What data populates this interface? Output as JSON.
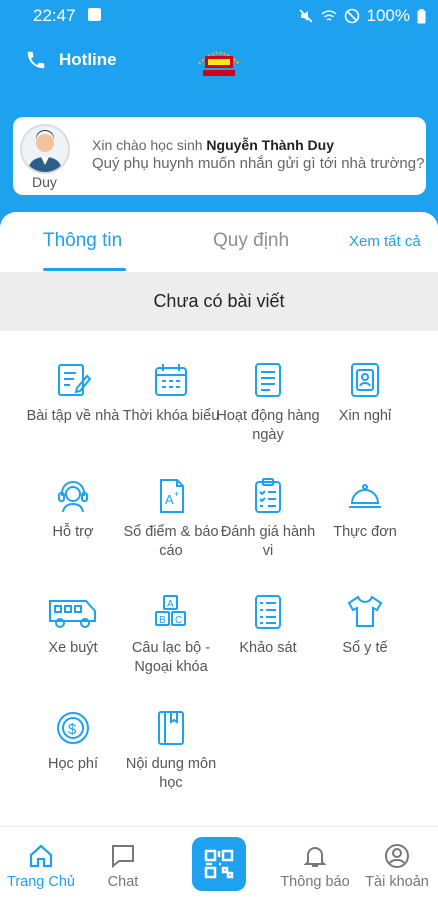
{
  "status": {
    "time": "22:47",
    "battery": "100%"
  },
  "header": {
    "hotline_label": "Hotline"
  },
  "greeting": {
    "avatar_name": "Duy",
    "prefix": "Xin chào học sinh",
    "student_name": "Nguyễn Thành Duy",
    "question": "Quý phụ huynh muốn nhắn gửi gì tới nhà trường?"
  },
  "tabs": {
    "info": "Thông tin",
    "rules": "Quy định",
    "see_all": "Xem tất cả"
  },
  "news": {
    "empty": "Chưa có bài viết"
  },
  "menu": [
    {
      "label": "Bài tập về nhà",
      "icon": "homework-icon"
    },
    {
      "label": "Thời khóa biểu",
      "icon": "calendar-icon"
    },
    {
      "label": "Hoạt động hàng ngày",
      "icon": "document-icon"
    },
    {
      "label": "Xin nghỉ",
      "icon": "leave-request-icon"
    },
    {
      "label": "Hỗ trợ",
      "icon": "headset-icon"
    },
    {
      "label": "Sổ điểm & báo cáo",
      "icon": "grade-icon"
    },
    {
      "label": "Đánh giá hành vi",
      "icon": "checklist-icon"
    },
    {
      "label": "Thực đơn",
      "icon": "food-cloche-icon"
    },
    {
      "label": "Xe buýt",
      "icon": "bus-icon"
    },
    {
      "label": "Câu lạc bộ - Ngoại khóa",
      "icon": "abc-blocks-icon"
    },
    {
      "label": "Khảo sát",
      "icon": "survey-icon"
    },
    {
      "label": "Sổ y tế",
      "icon": "shirt-icon"
    },
    {
      "label": "Học phí",
      "icon": "coin-icon"
    },
    {
      "label": "Nội dung môn học",
      "icon": "book-icon"
    }
  ],
  "bottom_nav": {
    "home": "Trang Chủ",
    "chat": "Chat",
    "notifications": "Thông báo",
    "account": "Tài khoản"
  },
  "colors": {
    "primary": "#1ea1ee",
    "background": "#ffffff"
  }
}
